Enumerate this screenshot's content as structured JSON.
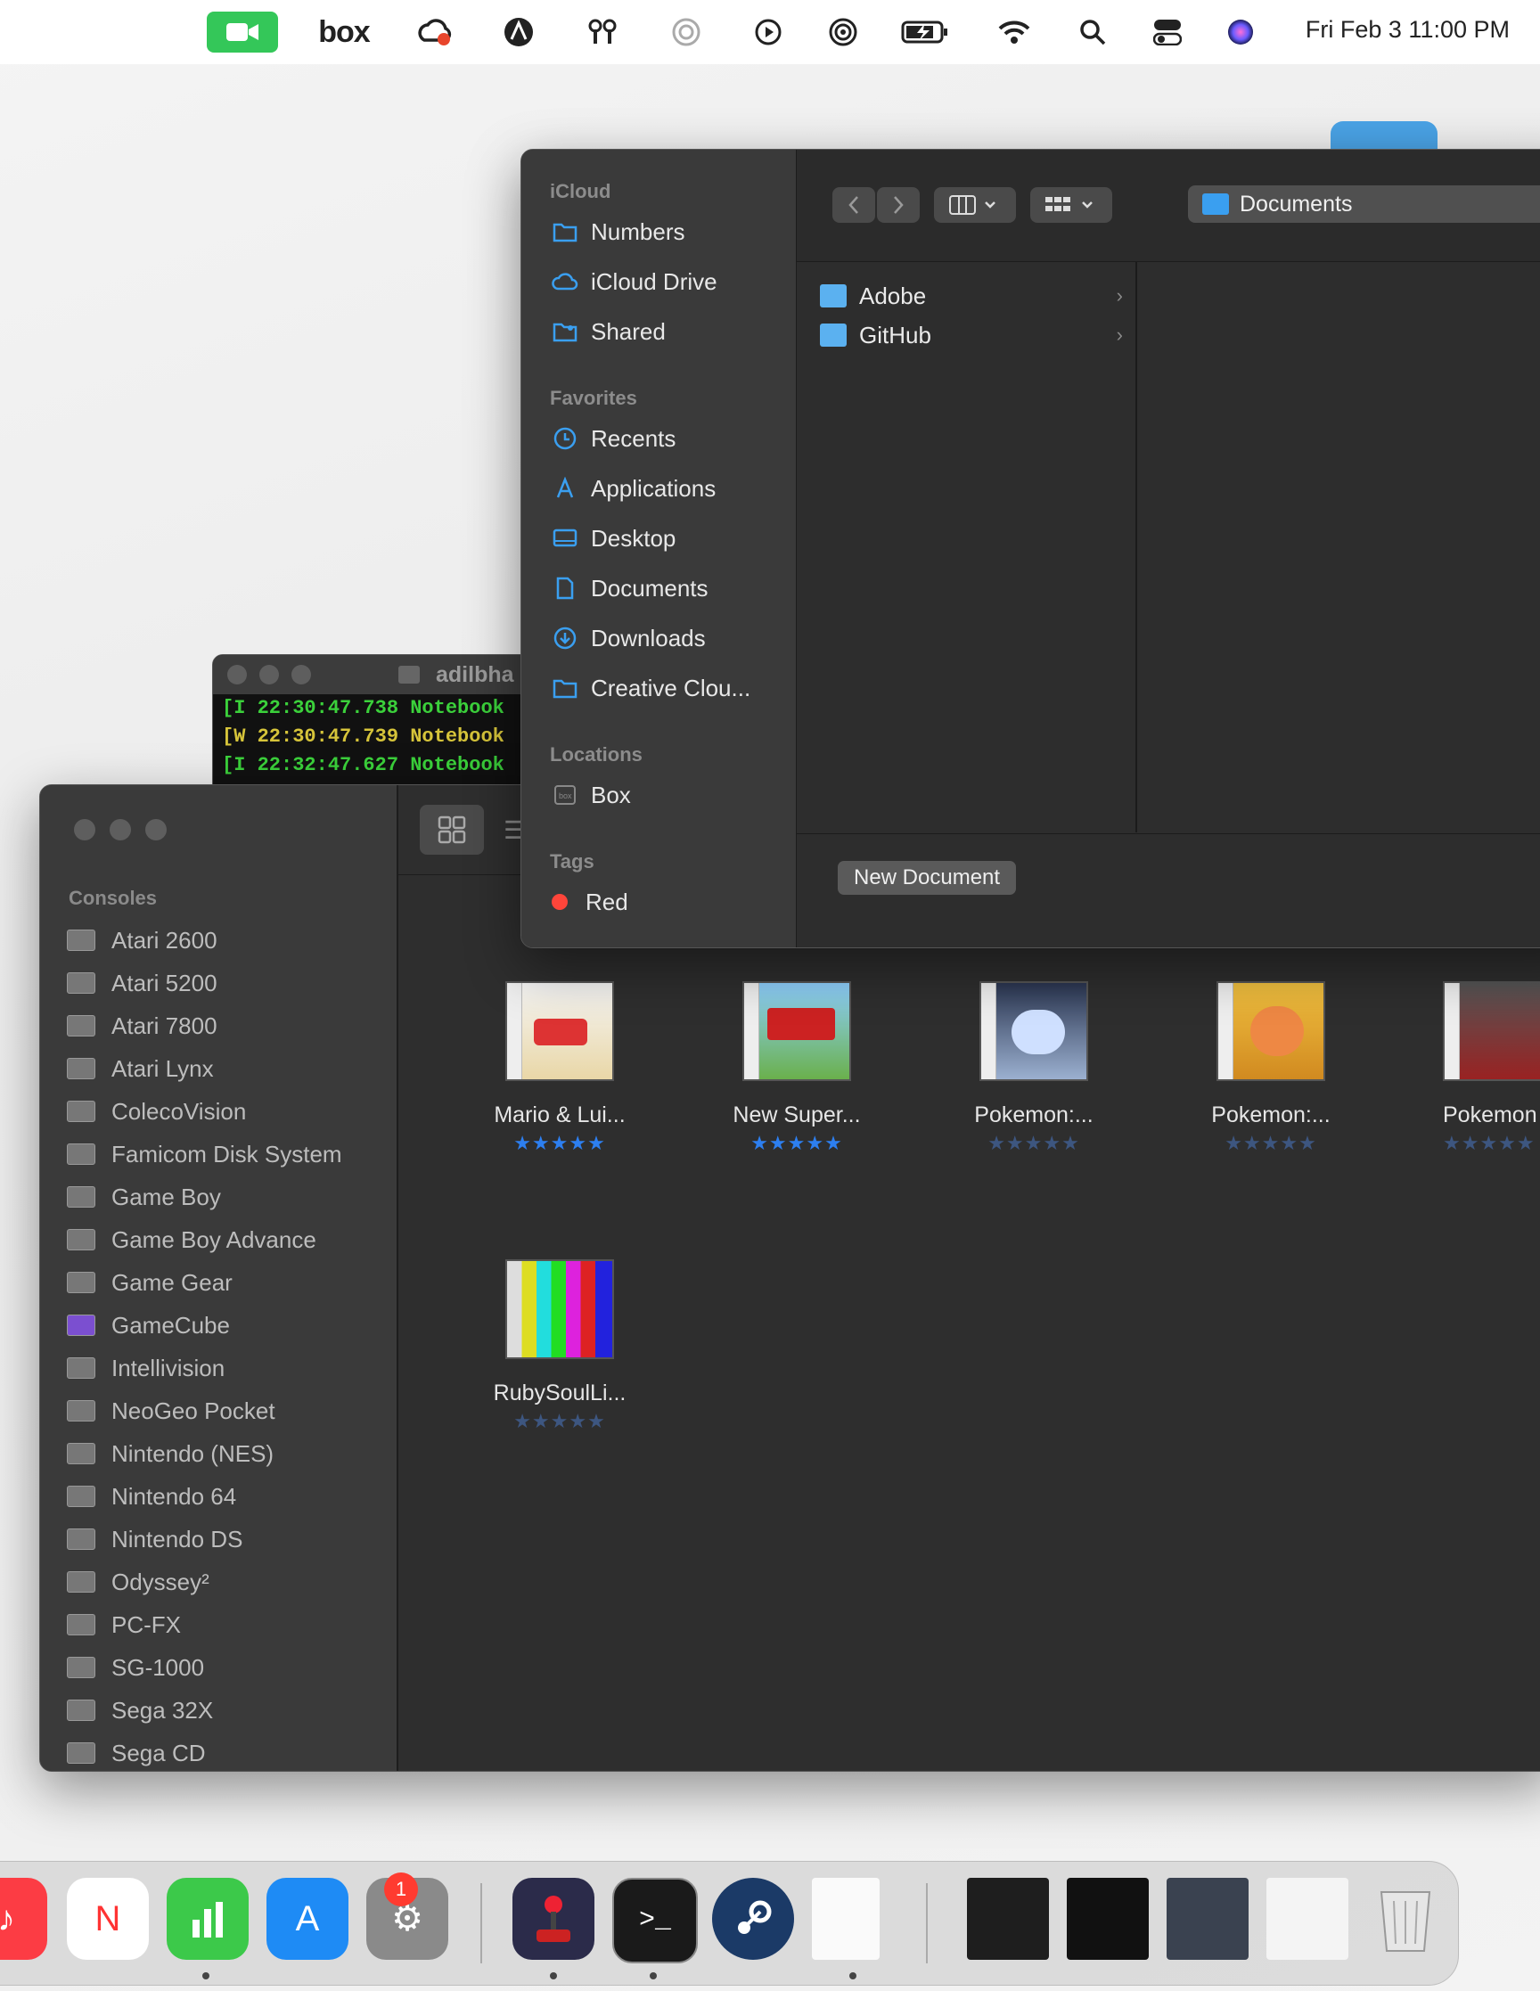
{
  "menubar": {
    "clock": "Fri Feb 3  11:00 PM",
    "box_label": "box",
    "icons": [
      "video-icon",
      "box-icon",
      "creative-cloud-icon",
      "adobe-icon",
      "antenna-icon",
      "moon-icon",
      "play-icon",
      "airdrop-icon",
      "battery-icon",
      "wifi-icon",
      "search-icon",
      "control-center-icon",
      "siri-icon"
    ]
  },
  "finder": {
    "sections": {
      "icloud": "iCloud",
      "favorites": "Favorites",
      "locations": "Locations",
      "tags": "Tags"
    },
    "icloud_items": [
      "Numbers",
      "iCloud Drive",
      "Shared"
    ],
    "favorite_items": [
      "Recents",
      "Applications",
      "Desktop",
      "Documents",
      "Downloads",
      "Creative Clou..."
    ],
    "location_items": [
      "Box"
    ],
    "tag_items": [
      "Red"
    ],
    "path_label": "Documents",
    "folders": [
      "Adobe",
      "GitHub"
    ],
    "new_document_label": "New Document"
  },
  "terminal": {
    "title": "adilbha",
    "lines": [
      {
        "text": "[I 22:30:47.738 Notebook",
        "color": "#3bd13b"
      },
      {
        "text": "[W 22:30:47.739 Notebook",
        "color": "#d6c43a"
      },
      {
        "text": "[I 22:32:47.627 Notebook",
        "color": "#3bd13b"
      }
    ]
  },
  "emu": {
    "section": "Consoles",
    "consoles": [
      "Atari 2600",
      "Atari 5200",
      "Atari 7800",
      "Atari Lynx",
      "ColecoVision",
      "Famicom Disk System",
      "Game Boy",
      "Game Boy Advance",
      "Game Gear",
      "GameCube",
      "Intellivision",
      "NeoGeo Pocket",
      "Nintendo (NES)",
      "Nintendo 64",
      "Nintendo DS",
      "Odyssey²",
      "PC-FX",
      "SG-1000",
      "Sega 32X",
      "Sega CD"
    ],
    "games": [
      {
        "title": "Mario & Lui...",
        "stars": "★★★★★",
        "rated": true
      },
      {
        "title": "New Super...",
        "stars": "★★★★★",
        "rated": true
      },
      {
        "title": "Pokemon:...",
        "stars": "★★★★★",
        "rated": false
      },
      {
        "title": "Pokemon:...",
        "stars": "★★★★★",
        "rated": false
      },
      {
        "title": "Pokemon",
        "stars": "★★★★★",
        "rated": false
      },
      {
        "title": "RubySoulLi...",
        "stars": "★★★★★",
        "rated": false
      }
    ]
  },
  "dock": {
    "badge": "1",
    "apps": [
      "music-icon",
      "news-icon",
      "numbers-icon",
      "app-store-icon",
      "system-settings-icon",
      "openemu-icon",
      "terminal-icon",
      "steam-icon",
      "document-icon",
      "window-preview-notes",
      "window-preview-terminal-chrome",
      "window-preview-messages",
      "window-preview-chrome",
      "trash-icon"
    ]
  }
}
